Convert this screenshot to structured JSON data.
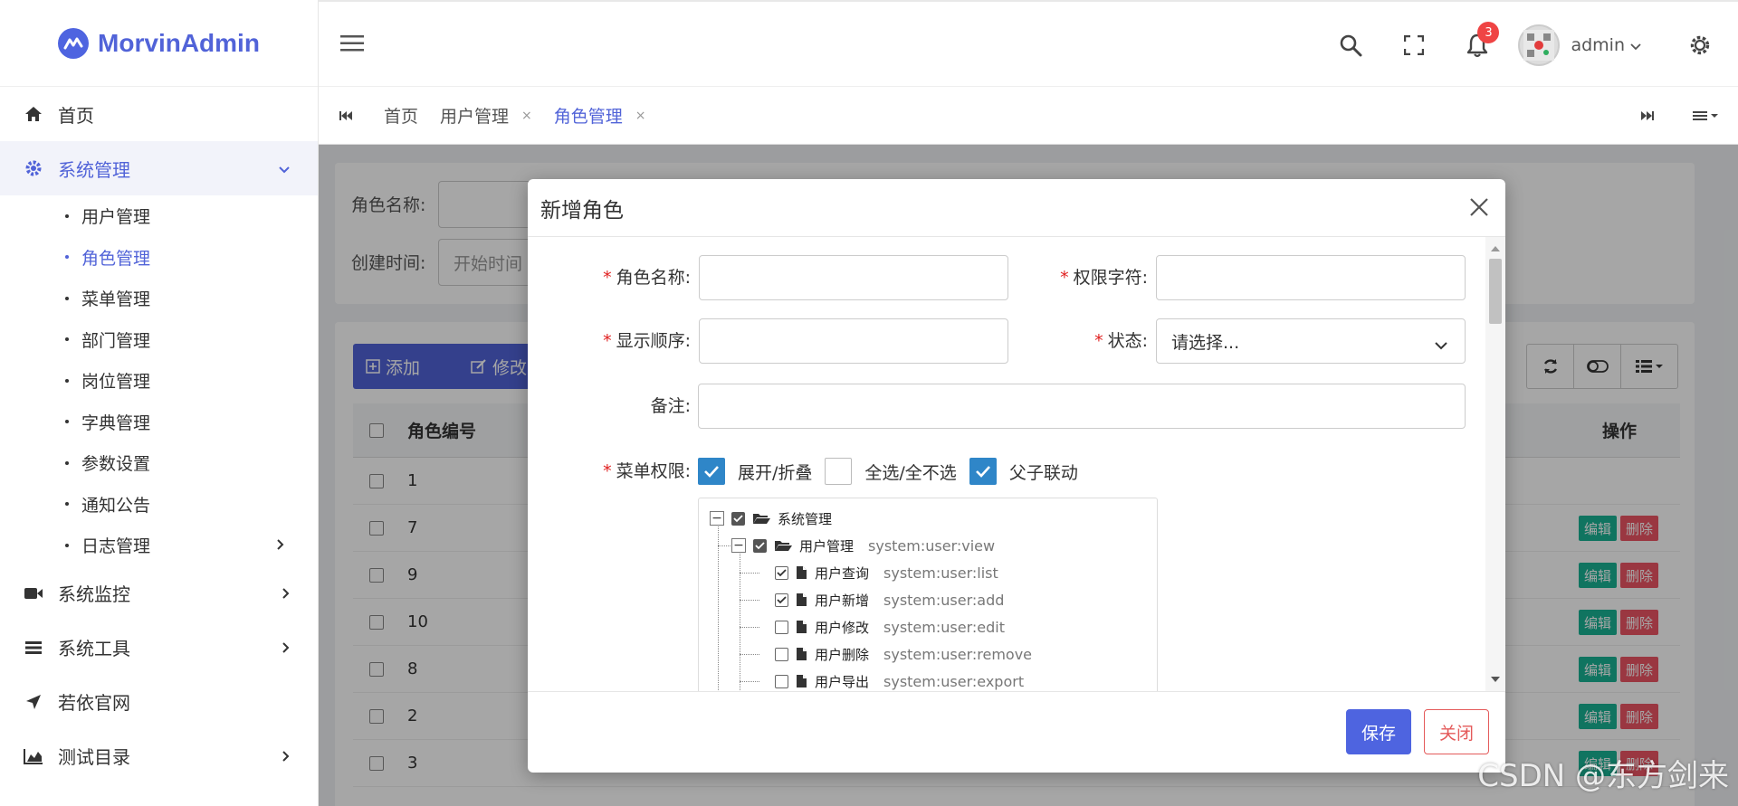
{
  "app": {
    "name": "MorvinAdmin",
    "brand_color": "#5163d8"
  },
  "sidebar": {
    "items": [
      {
        "label": "首页",
        "icon": "home-icon"
      },
      {
        "label": "系统管理",
        "icon": "gear-icon",
        "expanded": true
      },
      {
        "label": "系统监控",
        "icon": "video-icon"
      },
      {
        "label": "系统工具",
        "icon": "list-icon"
      },
      {
        "label": "若依官网",
        "icon": "location-arrow-icon"
      },
      {
        "label": "测试目录",
        "icon": "area-chart-icon"
      }
    ],
    "submenu": [
      {
        "label": "用户管理"
      },
      {
        "label": "角色管理",
        "active": true
      },
      {
        "label": "菜单管理"
      },
      {
        "label": "部门管理"
      },
      {
        "label": "岗位管理"
      },
      {
        "label": "字典管理"
      },
      {
        "label": "参数设置"
      },
      {
        "label": "通知公告"
      },
      {
        "label": "日志管理"
      }
    ]
  },
  "header": {
    "notification_count": "3",
    "user_name": "admin"
  },
  "tabs": [
    {
      "label": "首页"
    },
    {
      "label": "用户管理",
      "close": "×"
    },
    {
      "label": "角色管理",
      "close": "×",
      "active": true
    }
  ],
  "search": {
    "role_name_label": "角色名称:",
    "create_time_label": "创建时间:",
    "start_time_placeholder": "开始时间"
  },
  "toolbar": {
    "add_label": "添加",
    "edit_label": "修改"
  },
  "table": {
    "col_id": "角色编号",
    "col_actions": "操作",
    "rows": [
      {
        "id": "1",
        "has_actions": false
      },
      {
        "id": "7"
      },
      {
        "id": "9"
      },
      {
        "id": "10"
      },
      {
        "id": "8"
      },
      {
        "id": "2"
      },
      {
        "id": "3"
      }
    ],
    "edit_label": "编辑",
    "delete_label": "删除"
  },
  "modal": {
    "title": "新增角色",
    "role_name_label": "角色名称:",
    "perm_key_label": "权限字符:",
    "order_label": "显示顺序:",
    "status_label": "状态:",
    "status_placeholder": "请选择...",
    "remark_label": "备注:",
    "menu_perm_label": "菜单权限:",
    "expand_label": "展开/折叠",
    "select_all_label": "全选/全不选",
    "linkage_label": "父子联动",
    "required_mark": "*",
    "tree": {
      "root": "系统管理",
      "user_mgmt": {
        "label": "用户管理",
        "perm": "system:user:view"
      },
      "children": [
        {
          "label": "用户查询",
          "perm": "system:user:list",
          "checked": true
        },
        {
          "label": "用户新增",
          "perm": "system:user:add",
          "checked": true
        },
        {
          "label": "用户修改",
          "perm": "system:user:edit",
          "checked": false
        },
        {
          "label": "用户删除",
          "perm": "system:user:remove",
          "checked": false
        },
        {
          "label": "用户导出",
          "perm": "system:user:export",
          "checked": false
        }
      ]
    },
    "save_label": "保存",
    "close_label": "关闭"
  },
  "watermark": "CSDN @东方剑来"
}
